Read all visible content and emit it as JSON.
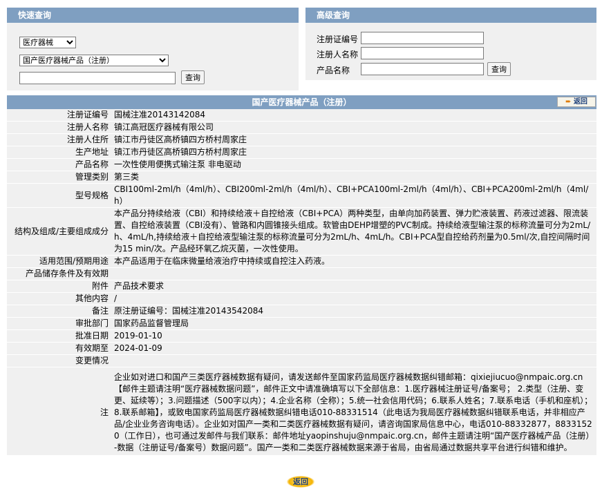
{
  "quick": {
    "title": "快速查询",
    "category_select": "医疗器械",
    "product_select": "国产医疗器械产品（注册）",
    "keyword_value": "",
    "query_button": "查询"
  },
  "advanced": {
    "title": "高级查询",
    "reg_no_label": "注册证编号",
    "registrant_label": "注册人名称",
    "product_label": "产品名称",
    "query_button": "查询"
  },
  "detail": {
    "title": "国产医疗器械产品（注册）",
    "back_label": "返回",
    "bottom_back_label": "返回",
    "rows": [
      {
        "k": "注册证编号",
        "v": "国械注准20143142084"
      },
      {
        "k": "注册人名称",
        "v": "镇江高冠医疗器械有限公司"
      },
      {
        "k": "注册人住所",
        "v": "镇江市丹徒区高桥镇四方桥村周家庄"
      },
      {
        "k": "生产地址",
        "v": "镇江市丹徒区高桥镇四方桥村周家庄"
      },
      {
        "k": "产品名称",
        "v": "一次性使用便携式输注泵 非电驱动"
      },
      {
        "k": "管理类别",
        "v": "第三类"
      },
      {
        "k": "型号规格",
        "v": "CBI100ml-2ml/h（4ml/h）、CBI200ml-2ml/h（4ml/h）、CBI+PCA100ml-2ml/h（4ml/h）、CBI+PCA200ml-2ml/h（4ml/h）"
      },
      {
        "k": "结构及组成/主要组成成分",
        "v": "本产品分持续给液（CBI）和持续给液＋自控给液（CBI+PCA）两种类型，由单向加药装置、弹力贮液装置、药液过滤器、限流装置、自控给液装置（CBI没有）、管路和内圆锥接头组成。软管由DEHP增塑的PVC制成。持续给液型输注泵的标称流量可分为2mL/h、4mL/h,持续给液＋自控给液型输注泵的标称流量可分为2mL/h、4mL/h。CBI+PCA型自控给药剂量为0.5ml/次,自控间隔时间为15 min/次。产品经环氧乙烷灭菌，一次性使用。"
      },
      {
        "k": "适用范围/预期用途",
        "v": "本产品适用于在临床微量给液治疗中持续或自控注入药液。"
      },
      {
        "k": "产品储存条件及有效期",
        "v": ""
      },
      {
        "k": "附件",
        "v": "产品技术要求"
      },
      {
        "k": "其他内容",
        "v": "/"
      },
      {
        "k": "备注",
        "v": "原注册证编号：国械注准20143542084"
      },
      {
        "k": "审批部门",
        "v": "国家药品监督管理局"
      },
      {
        "k": "批准日期",
        "v": "2019-01-10"
      },
      {
        "k": "有效期至",
        "v": "2024-01-09"
      },
      {
        "k": "变更情况",
        "v": ""
      },
      {
        "k": "注",
        "v": "企业如对进口和国产三类医疗器械数据有疑问，请发送邮件至国家药监局医疗器械数据纠错邮箱：qixiejiucuo@nmpaic.org.cn【邮件主题请注明“医疗器械数据问题”，邮件正文中请准确填写以下全部信息：1.医疗器械注册证号/备案号； 2.类型（注册、变更、延续等）；3.问题描述（500字以内）；4.企业名称（全称）；5.统一社会信用代码；6.联系人姓名；7.联系电话（手机和座机）；8.联系邮箱】，或致电国家药监局医疗器械数据纠错电话010-88331514（此电话为我局医疗器械数据纠错联系电话，并非相应产品/企业业务咨询电话）。企业如对国产一类和二类医疗器械数据有疑问，请咨询国家局信息中心，电话010-88332877，88331520（工作日），也可通过发邮件与我们联系：邮件地址yaopinshuju@nmpaic.org.cn，邮件主题请注明“国产医疗器械产品（注册）-数据（注册证号/备案号）数据问题”。国产一类和二类医疗器械数据来源于省局，由省局通过数据共享平台进行纠错和维护。"
      }
    ]
  }
}
